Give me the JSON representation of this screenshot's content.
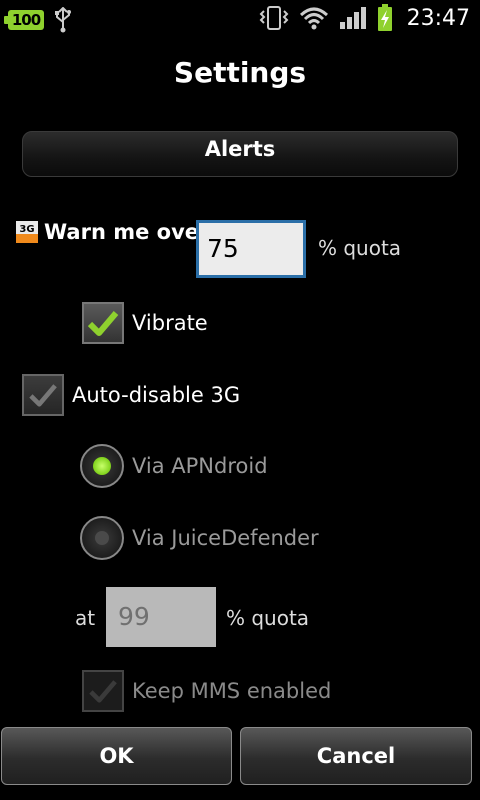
{
  "status_bar": {
    "battery_level": "100",
    "time": "23:47",
    "icons": [
      "battery-badge-icon",
      "usb-icon",
      "vibrate-icon",
      "wifi-icon",
      "signal-icon",
      "battery-charging-icon"
    ],
    "colors": {
      "battery_badge": "#8fd12e",
      "charging": "#8fd12e"
    }
  },
  "dialog": {
    "title": "Settings",
    "section_title": "Alerts",
    "warn": {
      "label": "Warn me over",
      "value": "75",
      "unit": "% quota",
      "icon": "3g-icon"
    },
    "vibrate": {
      "label": "Vibrate",
      "checked": true
    },
    "auto_disable": {
      "label": "Auto-disable 3G",
      "checked": true
    },
    "via_apndroid": {
      "label": "Via APNdroid",
      "selected": true
    },
    "via_juicedefender": {
      "label": "Via JuiceDefender",
      "selected": false
    },
    "threshold": {
      "prefix": "at",
      "value": "99",
      "unit": "% quota"
    },
    "keep_mms": {
      "label": "Keep MMS enabled",
      "checked": true,
      "enabled": false
    },
    "buttons": {
      "ok": "OK",
      "cancel": "Cancel"
    },
    "colors": {
      "field_border": "#2b6fa8",
      "check_green": "#8fd12e",
      "radio_green": "#9be63a"
    }
  }
}
